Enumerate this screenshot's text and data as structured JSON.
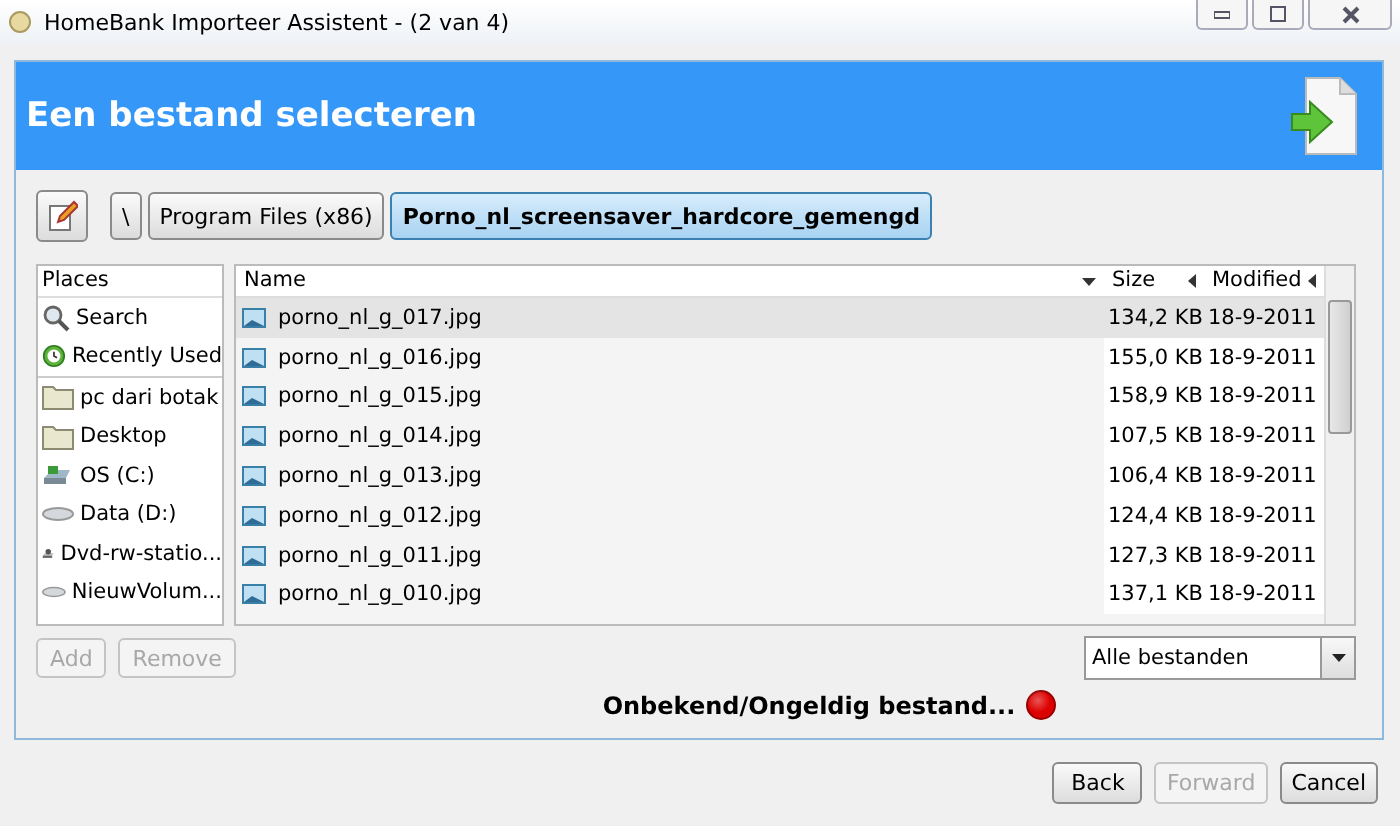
{
  "window": {
    "title": "HomeBank Importeer Assistent - (2 van 4)"
  },
  "header": {
    "title": "Een bestand selecteren"
  },
  "path_bar": [
    {
      "label": "\\",
      "selected": false
    },
    {
      "label": "Program Files (x86)",
      "selected": false
    },
    {
      "label": "Porno_nl_screensaver_hardcore_gemengd",
      "selected": true
    }
  ],
  "places": {
    "heading": "Places",
    "items": [
      {
        "label": "Search",
        "kind": "search"
      },
      {
        "label": "Recently Used",
        "kind": "recent"
      },
      {
        "label": "pc dari botak",
        "kind": "folder"
      },
      {
        "label": "Desktop",
        "kind": "folder"
      },
      {
        "label": "OS (C:)",
        "kind": "system"
      },
      {
        "label": "Data (D:)",
        "kind": "drive"
      },
      {
        "label": "Dvd-rw-statio...",
        "kind": "optical"
      },
      {
        "label": "NieuwVolum...",
        "kind": "drive"
      }
    ],
    "buttons": [
      {
        "label": "Add",
        "disabled": true
      },
      {
        "label": "Remove",
        "disabled": true
      }
    ]
  },
  "file_list": {
    "columns": [
      "Name",
      "Size",
      "Modified"
    ],
    "rows": [
      {
        "name": "porno_nl_g_017.jpg",
        "size": "134,2 KB",
        "modified": "18-9-2011",
        "selected": true
      },
      {
        "name": "porno_nl_g_016.jpg",
        "size": "155,0 KB",
        "modified": "18-9-2011",
        "selected": false
      },
      {
        "name": "porno_nl_g_015.jpg",
        "size": "158,9 KB",
        "modified": "18-9-2011",
        "selected": false
      },
      {
        "name": "porno_nl_g_014.jpg",
        "size": "107,5 KB",
        "modified": "18-9-2011",
        "selected": false
      },
      {
        "name": "porno_nl_g_013.jpg",
        "size": "106,4 KB",
        "modified": "18-9-2011",
        "selected": false
      },
      {
        "name": "porno_nl_g_012.jpg",
        "size": "124,4 KB",
        "modified": "18-9-2011",
        "selected": false
      },
      {
        "name": "porno_nl_g_011.jpg",
        "size": "127,3 KB",
        "modified": "18-9-2011",
        "selected": false
      },
      {
        "name": "porno_nl_g_010.jpg",
        "size": "137,1 KB",
        "modified": "18-9-2011",
        "selected": false
      }
    ]
  },
  "filter": {
    "value": "Alle bestanden"
  },
  "status": {
    "text": "Onbekend/Ongeldig bestand...",
    "color": "#dd0000"
  },
  "buttons": [
    {
      "label": "Back",
      "disabled": false
    },
    {
      "label": "Forward",
      "disabled": true
    },
    {
      "label": "Cancel",
      "disabled": false
    }
  ]
}
